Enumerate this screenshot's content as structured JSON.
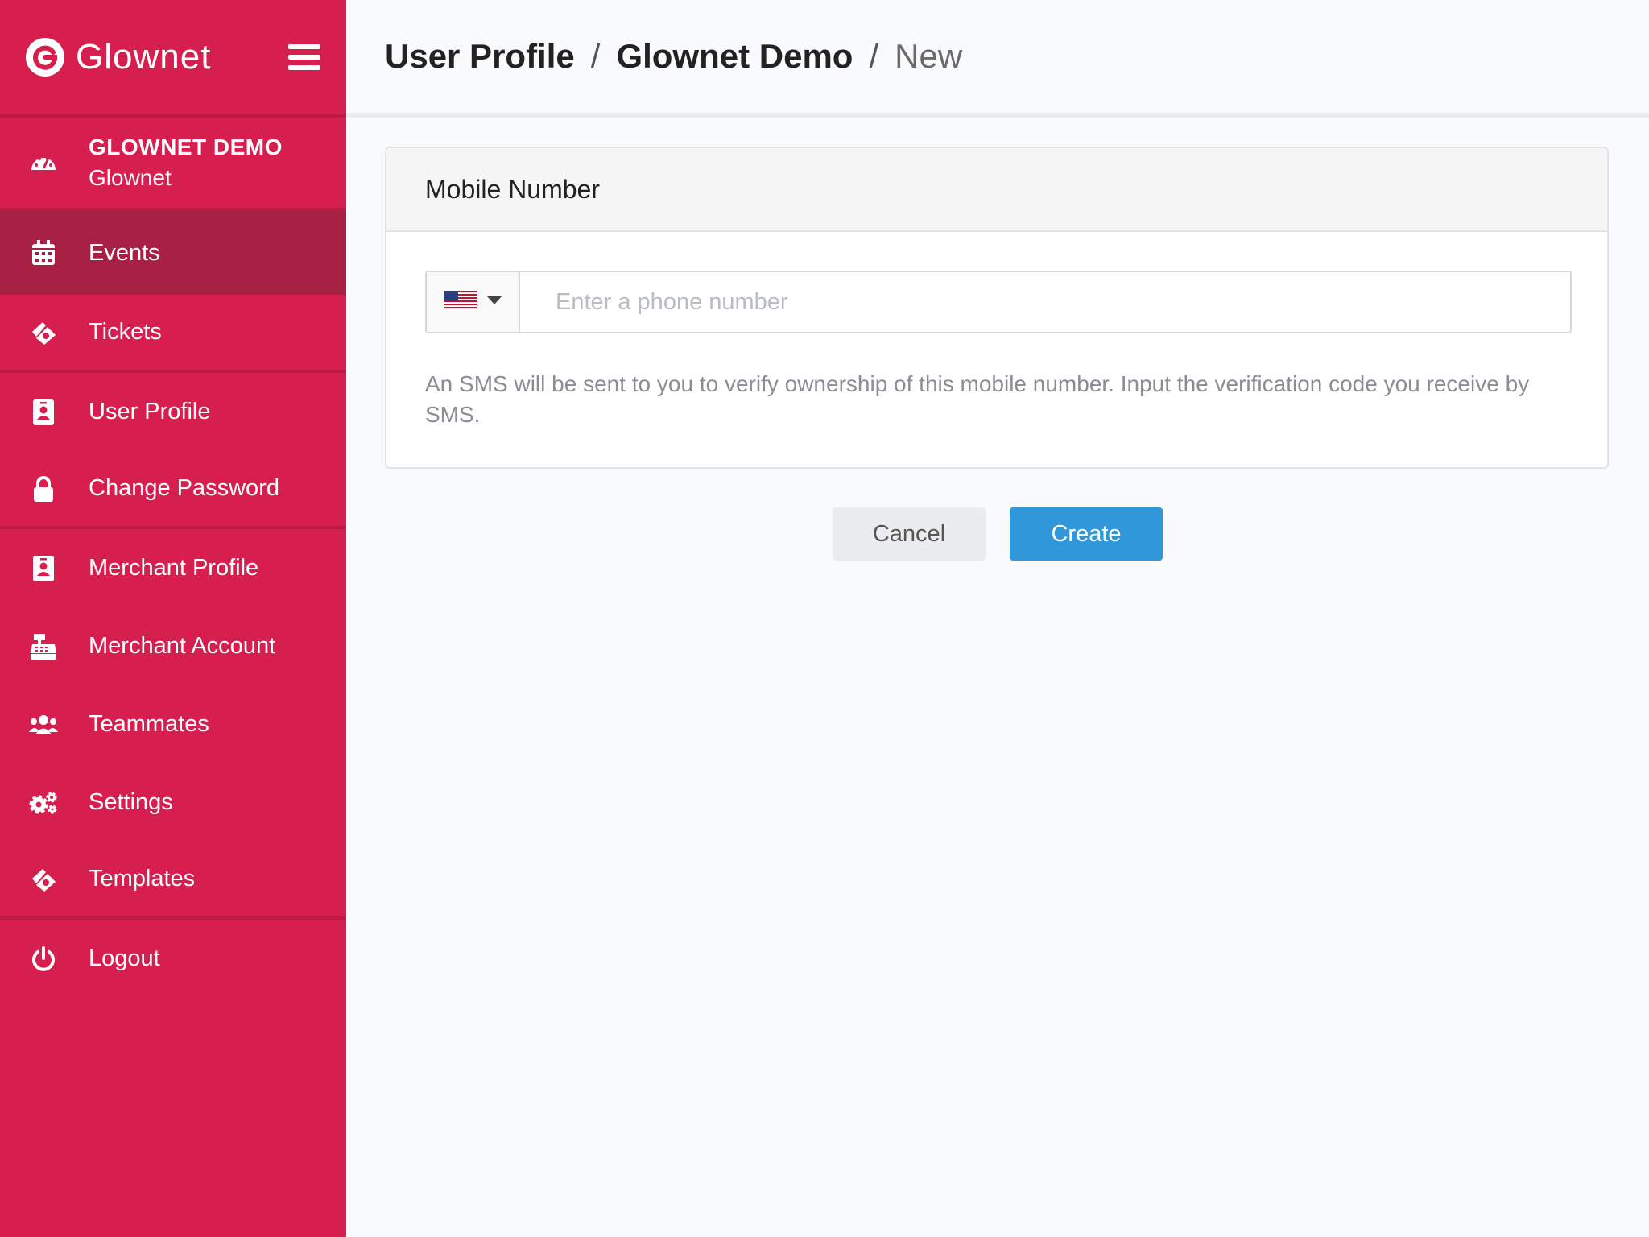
{
  "brand": {
    "name": "Glownet",
    "logo_letter": "G"
  },
  "sidebar": {
    "org": {
      "name": "GLOWNET DEMO",
      "sub": "Glownet"
    },
    "items": [
      {
        "label": "Events",
        "icon": "calendar-icon"
      },
      {
        "label": "Tickets",
        "icon": "ticket-icon"
      },
      {
        "label": "User Profile",
        "icon": "id-badge-icon"
      },
      {
        "label": "Change Password",
        "icon": "lock-icon"
      },
      {
        "label": "Merchant Profile",
        "icon": "id-badge-icon"
      },
      {
        "label": "Merchant Account",
        "icon": "cash-register-icon"
      },
      {
        "label": "Teammates",
        "icon": "users-icon"
      },
      {
        "label": "Settings",
        "icon": "gears-icon"
      },
      {
        "label": "Templates",
        "icon": "ticket-icon"
      },
      {
        "label": "Logout",
        "icon": "power-icon"
      }
    ]
  },
  "breadcrumb": {
    "part1": "User Profile",
    "sep1": "/",
    "part2": "Glownet Demo",
    "sep2": "/",
    "part3": "New"
  },
  "form": {
    "title": "Mobile Number",
    "phone_placeholder": "Enter a phone number",
    "phone_value": "",
    "country": "US",
    "help": "An SMS will be sent to you to verify ownership of this mobile number. Input the verification code you receive by SMS."
  },
  "actions": {
    "cancel": "Cancel",
    "create": "Create"
  },
  "colors": {
    "sidebar": "#d61f4e",
    "active": "#a82043",
    "primary": "#2f97da"
  }
}
